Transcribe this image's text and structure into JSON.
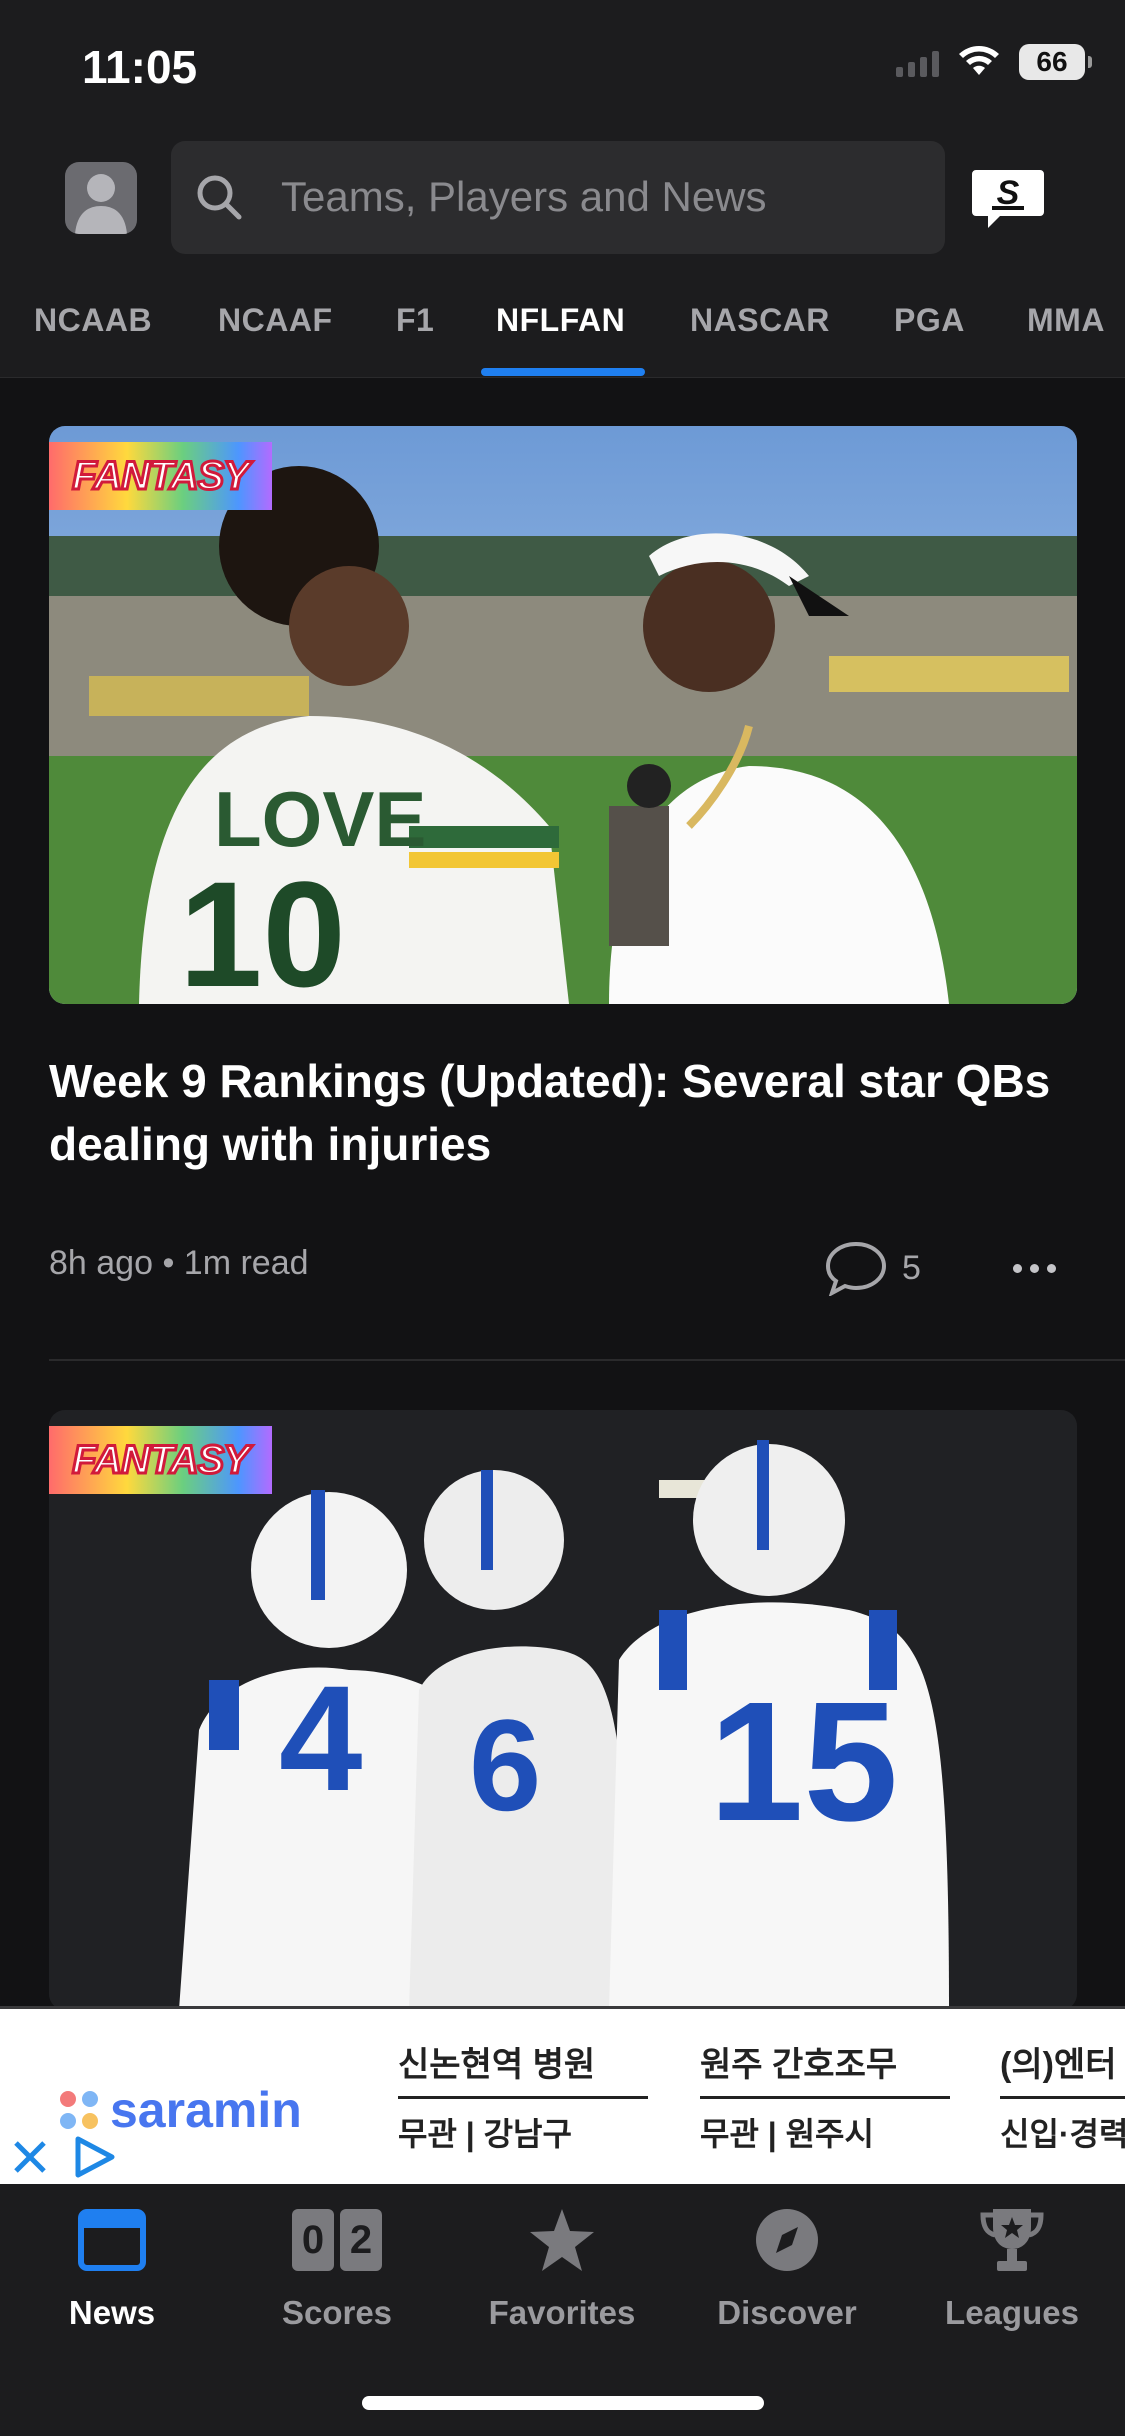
{
  "status_bar": {
    "time": "11:05",
    "battery": "66"
  },
  "header": {
    "search_placeholder": "Teams, Players and News"
  },
  "tabs": [
    {
      "label": "NCAAB"
    },
    {
      "label": "NCAAF"
    },
    {
      "label": "F1"
    },
    {
      "label": "NFLFAN",
      "active": true
    },
    {
      "label": "NASCAR"
    },
    {
      "label": "PGA"
    },
    {
      "label": "MMA"
    }
  ],
  "feed": {
    "articles": [
      {
        "badge": "FANTASY",
        "headline": "Week 9 Rankings (Updated): Several star QBs dealing with injuries",
        "meta": "8h ago • 1m read",
        "comments": "5"
      },
      {
        "badge": "FANTASY",
        "headline": "",
        "meta": "",
        "comments": ""
      }
    ]
  },
  "ad": {
    "brand": "saramin",
    "jobs": [
      {
        "title": "신논현역 병원",
        "sub": "무관 | 강남구"
      },
      {
        "title": "원주 간호조무",
        "sub": "무관 | 원주시"
      },
      {
        "title": "(의)엔터",
        "sub": "신입·경력"
      }
    ]
  },
  "bottom_nav": [
    {
      "label": "News",
      "icon": "news-icon",
      "active": true
    },
    {
      "label": "Scores",
      "icon": "scores-icon",
      "score_left": "0",
      "score_right": "2"
    },
    {
      "label": "Favorites",
      "icon": "star-icon"
    },
    {
      "label": "Discover",
      "icon": "compass-icon"
    },
    {
      "label": "Leagues",
      "icon": "trophy-icon"
    }
  ],
  "colors": {
    "accent": "#1f7ff0",
    "background": "#121214",
    "bar": "#1c1c1e",
    "ad_brand": "#4876ef"
  }
}
